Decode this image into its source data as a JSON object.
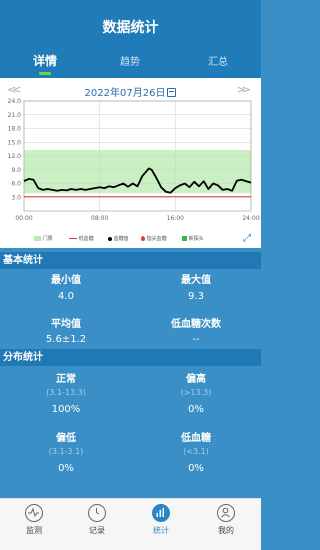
{
  "header": {
    "title": "数据统计",
    "tabs": [
      {
        "label": "详情",
        "active": true
      },
      {
        "label": "趋势",
        "active": false
      },
      {
        "label": "汇总",
        "active": false
      }
    ]
  },
  "chart_header": {
    "prev_icon": "double-chevron-left-icon",
    "date": "2022年07月26日",
    "calendar_icon": "calendar-icon",
    "next_icon": "double-chevron-right-icon"
  },
  "chart_data": {
    "type": "line",
    "title": "",
    "x_tick_labels": [
      "00:00",
      "08:00",
      "16:00",
      "24:00"
    ],
    "y_tick_labels": [
      "24.0",
      "21.0",
      "18.0",
      "15.0",
      "12.0",
      "9.0",
      "6.0",
      "3.0"
    ],
    "ylim": [
      0,
      24
    ],
    "xlim": [
      0,
      24
    ],
    "target_range": [
      3.9,
      13.3
    ],
    "low_threshold": 3.1,
    "grid": true,
    "series": [
      {
        "name": "血糖值",
        "color": "#000000",
        "x": [
          0,
          0.5,
          1,
          1.5,
          2,
          2.5,
          3,
          3.5,
          4,
          4.5,
          5,
          5.5,
          6,
          6.5,
          7,
          7.5,
          8,
          8.5,
          9,
          9.5,
          10,
          10.5,
          11,
          11.5,
          12,
          12.5,
          13,
          13.2,
          13.5,
          14,
          14.5,
          15,
          15.5,
          16,
          16.5,
          17,
          17.5,
          18,
          18.5,
          19,
          19.5,
          20,
          20.5,
          21,
          21.5,
          22,
          22.5,
          23,
          23.5,
          24
        ],
        "y": [
          6.5,
          7.0,
          6.8,
          5.0,
          4.6,
          4.8,
          4.6,
          4.4,
          4.6,
          4.5,
          4.8,
          4.6,
          4.8,
          4.6,
          4.8,
          5.0,
          5.2,
          5.0,
          5.4,
          5.2,
          5.6,
          6.0,
          5.3,
          6.0,
          5.4,
          7.6,
          8.8,
          9.3,
          9.0,
          7.2,
          5.2,
          4.2,
          4.0,
          5.0,
          5.6,
          6.0,
          5.2,
          6.4,
          5.4,
          6.5,
          4.8,
          6.0,
          5.6,
          4.6,
          4.8,
          4.4,
          6.6,
          6.8,
          6.5,
          6.2
        ]
      }
    ],
    "legend": [
      {
        "name": "门限",
        "color": "#b6ecb0",
        "shape": "rect"
      },
      {
        "name": "低血糖",
        "color": "#d33",
        "shape": "line"
      },
      {
        "name": "血糖值",
        "color": "#000000",
        "shape": "line"
      },
      {
        "name": "指尖血糖",
        "color": "#e23b3b",
        "shape": "drop"
      },
      {
        "name": "新探头",
        "color": "#3bb34a",
        "shape": "rect"
      }
    ]
  },
  "basic_stats": {
    "title": "基本统计",
    "min_label": "最小值",
    "min_value": "4.0",
    "max_label": "最大值",
    "max_value": "9.3",
    "avg_label": "平均值",
    "avg_value": "5.6±1.2",
    "low_count_label": "低血糖次数",
    "low_count_value": "--"
  },
  "distribution": {
    "title": "分布统计",
    "normal_label": "正常",
    "normal_range": "(3.1-13.3)",
    "normal_value": "100%",
    "high_label": "偏高",
    "high_range": "(>13.3)",
    "high_value": "0%",
    "low_label": "偏低",
    "low_range": "(3.1-3.1)",
    "low_value": "0%",
    "hypo_label": "低血糖",
    "hypo_range": "(<3.1)",
    "hypo_value": "0%"
  },
  "bottom_nav": [
    {
      "label": "监测",
      "icon": "heartbeat-icon",
      "active": false
    },
    {
      "label": "记录",
      "icon": "clock-icon",
      "active": false
    },
    {
      "label": "统计",
      "icon": "bar-chart-icon",
      "active": true
    },
    {
      "label": "我的",
      "icon": "user-icon",
      "active": false
    }
  ]
}
